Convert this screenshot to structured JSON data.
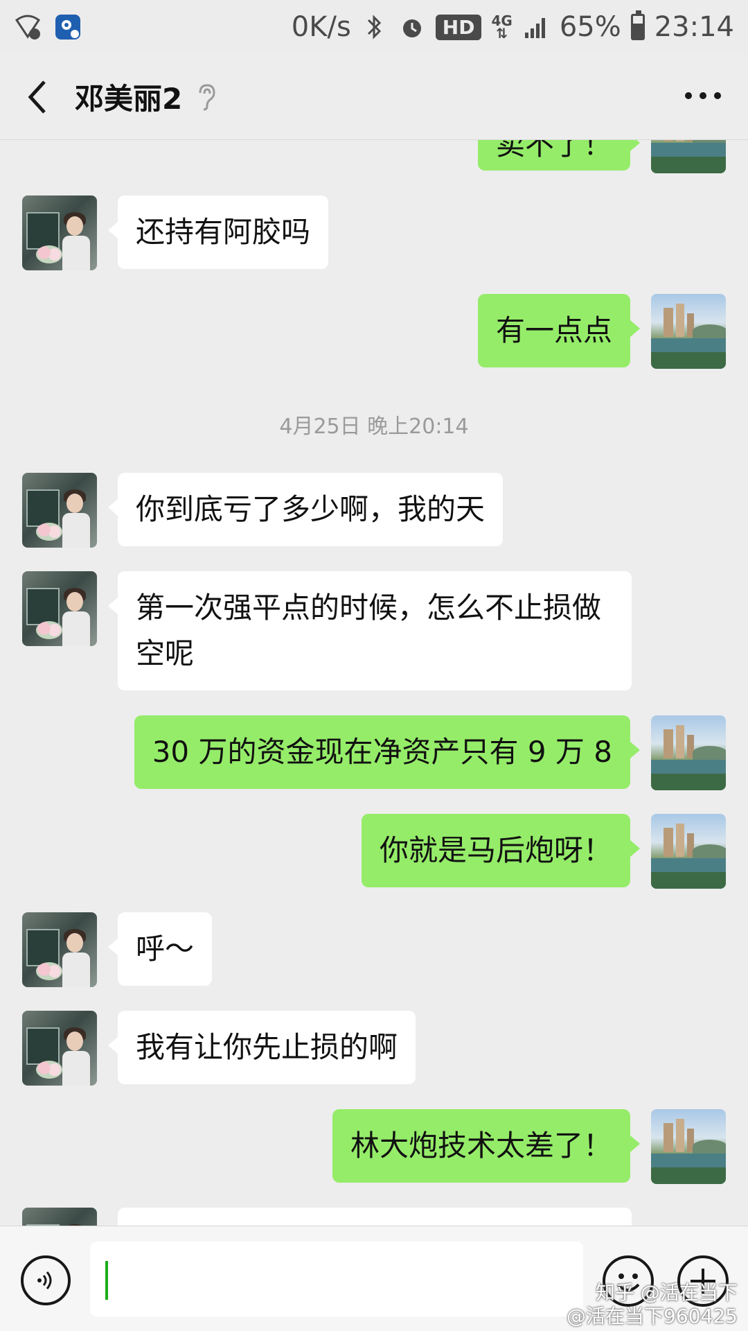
{
  "status_bar": {
    "net_speed": "0K/s",
    "hd_badge": "HD",
    "network": "4G",
    "battery_percent": "65%",
    "battery_level": 0.65,
    "time": "23:14"
  },
  "header": {
    "title": "邓美丽2"
  },
  "messages": [
    {
      "id": "m0",
      "side": "out",
      "text": "卖不了！",
      "partial": true
    },
    {
      "id": "m1",
      "side": "in",
      "text": "还持有阿胶吗"
    },
    {
      "id": "m2",
      "side": "out",
      "text": "有一点点"
    },
    {
      "id": "ts1",
      "type": "timestamp",
      "text": "4月25日 晚上20:14"
    },
    {
      "id": "m3",
      "side": "in",
      "text": "你到底亏了多少啊，我的天"
    },
    {
      "id": "m4",
      "side": "in",
      "text": "第一次强平点的时候，怎么不止损做空呢"
    },
    {
      "id": "m5",
      "side": "out",
      "text": "30 万的资金现在净资产只有 9 万 8"
    },
    {
      "id": "m6",
      "side": "out",
      "text": "你就是马后炮呀！"
    },
    {
      "id": "m7",
      "side": "in",
      "text": "呼～"
    },
    {
      "id": "m8",
      "side": "in",
      "text": "我有让你先止损的啊"
    },
    {
      "id": "m9",
      "side": "out",
      "text": "林大炮技术太差了！"
    }
  ],
  "input": {
    "value": "",
    "placeholder": ""
  },
  "watermark": {
    "line1": "知乎 @活在当下",
    "line2": "@活在当下960425"
  },
  "colors": {
    "outgoing_bubble": "#95ec69",
    "incoming_bubble": "#ffffff",
    "background": "#ededed"
  }
}
